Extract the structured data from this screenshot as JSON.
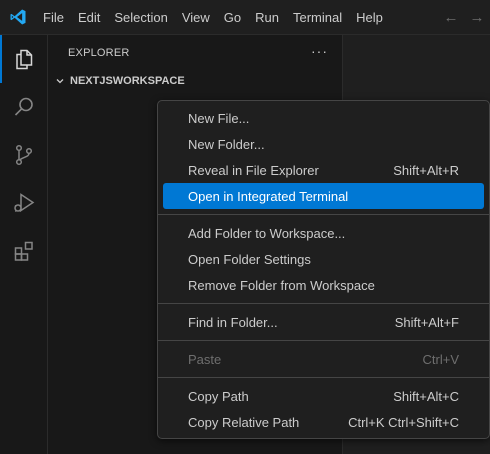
{
  "menubar": {
    "items": [
      "File",
      "Edit",
      "Selection",
      "View",
      "Go",
      "Run",
      "Terminal",
      "Help"
    ],
    "back": "←",
    "forward": "→"
  },
  "activitybar": {
    "icons": [
      "explorer-icon",
      "search-icon",
      "source-control-icon",
      "run-debug-icon",
      "extensions-icon"
    ]
  },
  "sidebar": {
    "title": "EXPLORER",
    "more": "···",
    "workspace": "NEXTJSWORKSPACE"
  },
  "context_menu": {
    "groups": [
      [
        {
          "label": "New File...",
          "shortcut": ""
        },
        {
          "label": "New Folder...",
          "shortcut": ""
        },
        {
          "label": "Reveal in File Explorer",
          "shortcut": "Shift+Alt+R"
        },
        {
          "label": "Open in Integrated Terminal",
          "shortcut": "",
          "selected": true
        }
      ],
      [
        {
          "label": "Add Folder to Workspace...",
          "shortcut": ""
        },
        {
          "label": "Open Folder Settings",
          "shortcut": ""
        },
        {
          "label": "Remove Folder from Workspace",
          "shortcut": ""
        }
      ],
      [
        {
          "label": "Find in Folder...",
          "shortcut": "Shift+Alt+F"
        }
      ],
      [
        {
          "label": "Paste",
          "shortcut": "Ctrl+V",
          "disabled": true
        }
      ],
      [
        {
          "label": "Copy Path",
          "shortcut": "Shift+Alt+C"
        },
        {
          "label": "Copy Relative Path",
          "shortcut": "Ctrl+K Ctrl+Shift+C"
        }
      ]
    ]
  },
  "colors": {
    "accent": "#0078d4",
    "logo": "#23a8f2"
  }
}
